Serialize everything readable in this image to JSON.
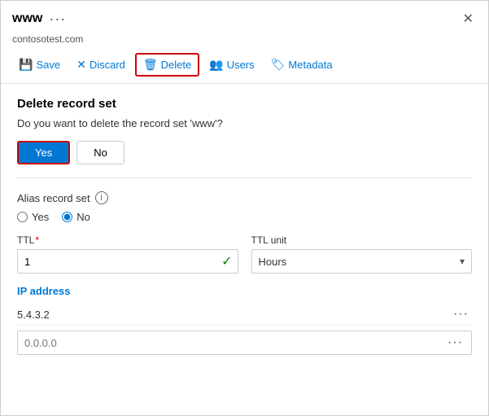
{
  "window": {
    "title": "www",
    "subtitle": "contosotest.com",
    "close_label": "✕"
  },
  "toolbar": {
    "save_label": "Save",
    "discard_label": "Discard",
    "delete_label": "Delete",
    "users_label": "Users",
    "metadata_label": "Metadata"
  },
  "delete_section": {
    "title": "Delete record set",
    "question": "Do you want to delete the record set 'www'?",
    "yes_label": "Yes",
    "no_label": "No"
  },
  "alias_section": {
    "label": "Alias record set",
    "yes_label": "Yes",
    "no_label": "No",
    "selected": "no"
  },
  "ttl_section": {
    "ttl_label": "TTL",
    "ttl_unit_label": "TTL unit",
    "ttl_value": "1",
    "ttl_unit_value": "Hours"
  },
  "ip_section": {
    "title": "IP address",
    "existing_ip": "5.4.3.2",
    "new_ip_placeholder": "0.0.0.0"
  }
}
